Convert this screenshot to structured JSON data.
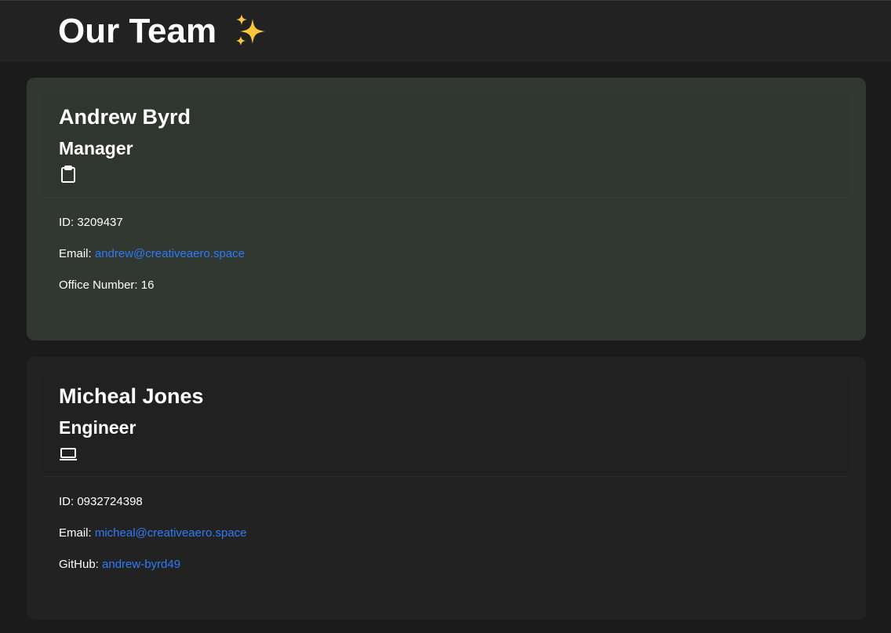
{
  "header": {
    "title": "Our Team",
    "emoji_icon": "sparkles-icon"
  },
  "colors": {
    "link": "#2f7bf5",
    "manager_card_bg": "#313731",
    "engineer_card_bg": "#222222",
    "page_bg": "#1b1b1b",
    "header_bg": "#222222"
  },
  "team": [
    {
      "name": "Andrew Byrd",
      "role": "Manager",
      "role_icon": "clipboard-icon",
      "id_label": "ID:",
      "id": "3209437",
      "email_label": "Email:",
      "email": "andrew@creativeaero.space",
      "extra_label": "Office Number:",
      "extra_value": "16"
    },
    {
      "name": "Micheal Jones",
      "role": "Engineer",
      "role_icon": "laptop-icon",
      "id_label": "ID:",
      "id": "0932724398",
      "email_label": "Email:",
      "email": "micheal@creativeaero.space",
      "extra_label": "GitHub:",
      "extra_value": "andrew-byrd49"
    }
  ]
}
